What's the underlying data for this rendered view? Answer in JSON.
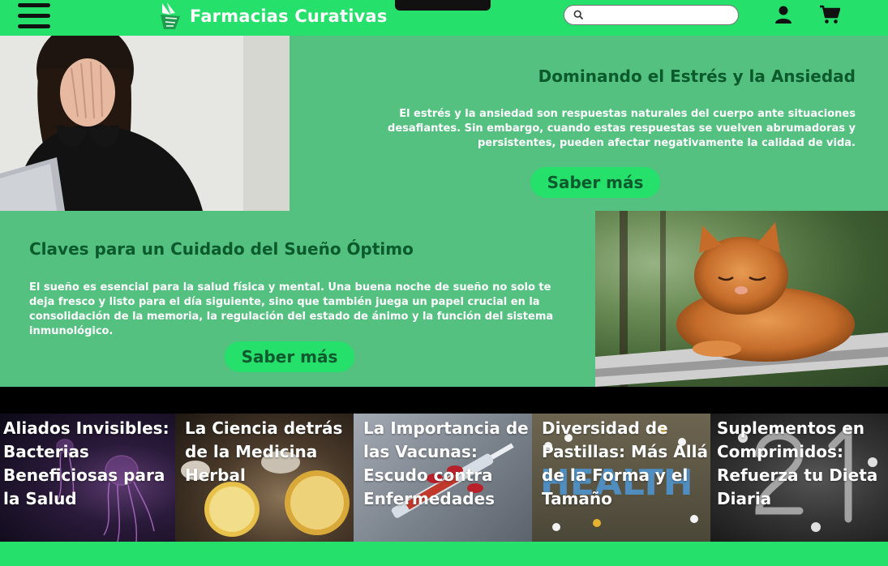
{
  "header": {
    "brand_name": "Farmacias Curativas",
    "search_placeholder": "",
    "colors": {
      "bar": "#25e06a",
      "brand_text": "#ffffff"
    },
    "icons": [
      "menu-icon",
      "logo-icon",
      "search-icon",
      "user-icon",
      "cart-icon"
    ]
  },
  "section1": {
    "title": "Dominando el Estrés y la Ansiedad",
    "body": "El estrés y la ansiedad son respuestas naturales del cuerpo ante situaciones desafiantes. Sin embargo, cuando estas respuestas se vuelven abrumadoras y persistentes, pueden afectar negativamente la calidad de vida.",
    "button_label": "Saber más",
    "colors": {
      "background": "#54c181",
      "title": "#0b5a2c",
      "button": "#25e06a"
    }
  },
  "section2": {
    "title": "Claves para un Cuidado del Sueño Óptimo",
    "body": "El sueño es esencial para la salud física y mental. Una buena noche de sueño no solo te deja fresco y listo para el día siguiente, sino que también juega un papel crucial en la consolidación de la memoria, la regulación del estado de ánimo y la función del sistema inmunológico.",
    "button_label": "Saber más"
  },
  "cards": [
    {
      "title": "Aliados Invisibles: Bacterias Beneficiosas para la Salud"
    },
    {
      "title": "La Ciencia detrás de la Medicina Herbal"
    },
    {
      "title": "La Importancia de las Vacunas: Escudo contra Enfermedades"
    },
    {
      "title": "Diversidad de Pastillas: Más Allá de la Forma y el Tamaño"
    },
    {
      "title": "Suplementos en Comprimidos: Refuerza tu Dieta Diaria"
    }
  ],
  "card_decor": {
    "health_letters": "HEALTH"
  }
}
